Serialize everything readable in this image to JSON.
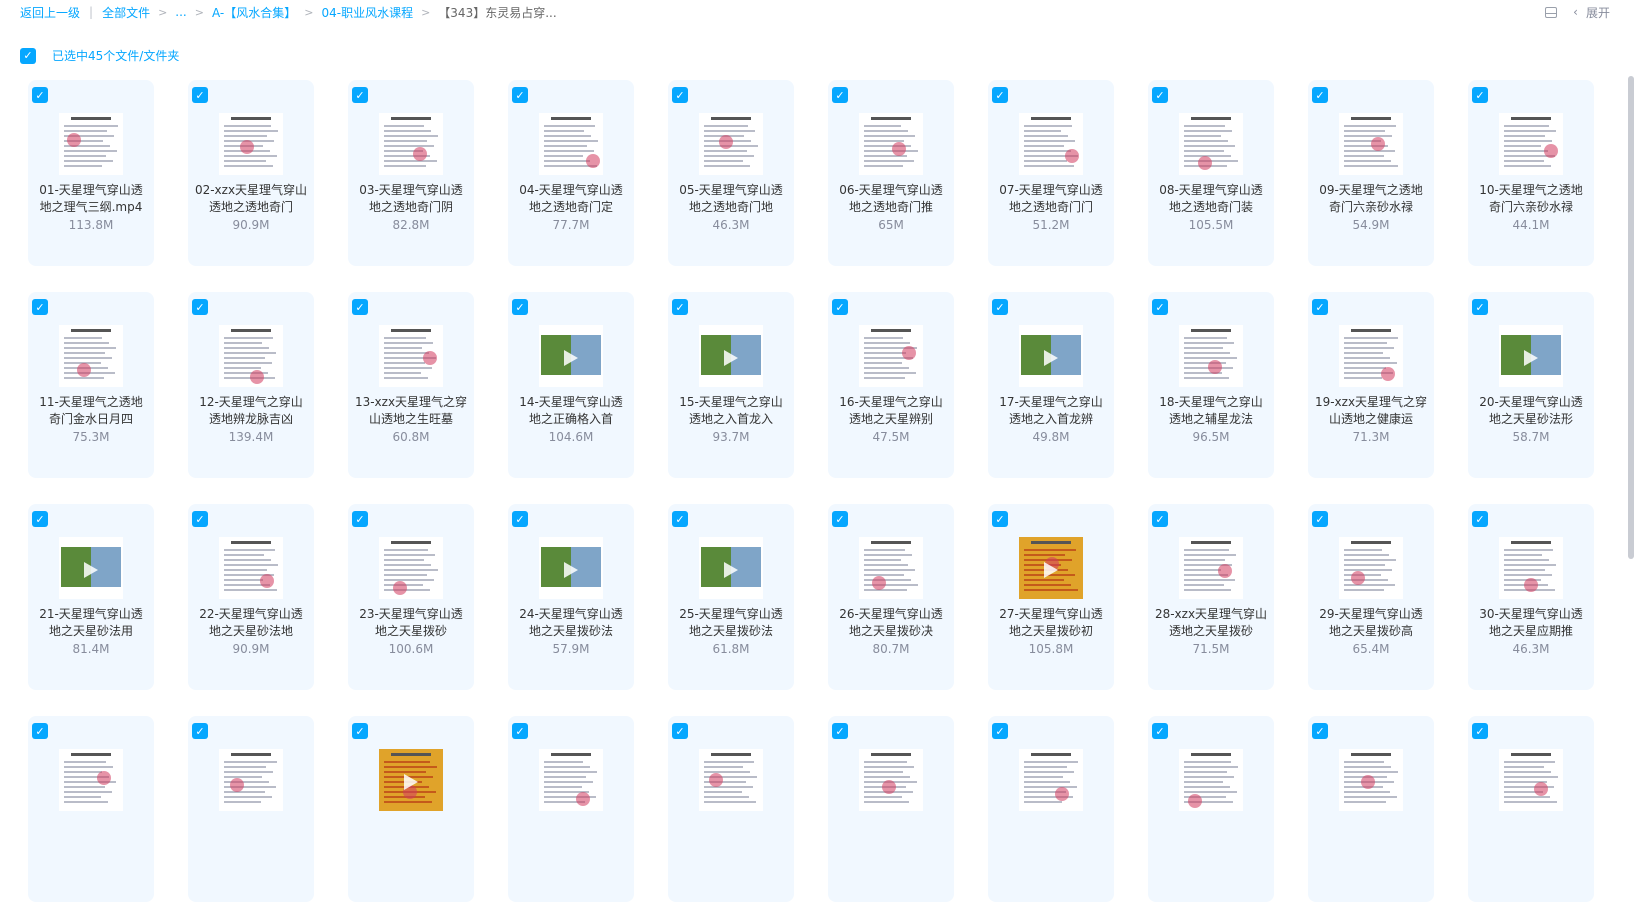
{
  "breadcrumb": {
    "back": "返回上一级",
    "items": [
      "全部文件",
      "...",
      "A-【风水合集】",
      "04-职业风水课程",
      "【343】东灵易占穿..."
    ]
  },
  "toolbar": {
    "expand_label": "展开"
  },
  "selection": {
    "text": "已选中45个文件/文件夹"
  },
  "files": [
    {
      "name": "01-天星理气穿山透地之理气三纲.mp4",
      "size": "113.8M",
      "thumb": "doc"
    },
    {
      "name": "02-xzx天星理气穿山透地之透地奇门",
      "size": "90.9M",
      "thumb": "doc"
    },
    {
      "name": "03-天星理气穿山透地之透地奇门阴",
      "size": "82.8M",
      "thumb": "doc"
    },
    {
      "name": "04-天星理气穿山透地之透地奇门定",
      "size": "77.7M",
      "thumb": "doc"
    },
    {
      "name": "05-天星理气穿山透地之透地奇门地",
      "size": "46.3M",
      "thumb": "doc"
    },
    {
      "name": "06-天星理气穿山透地之透地奇门推",
      "size": "65M",
      "thumb": "doc"
    },
    {
      "name": "07-天星理气穿山透地之透地奇门门",
      "size": "51.2M",
      "thumb": "doc"
    },
    {
      "name": "08-天星理气穿山透地之透地奇门装",
      "size": "105.5M",
      "thumb": "doc"
    },
    {
      "name": "09-天星理气之透地奇门六亲砂水禄",
      "size": "54.9M",
      "thumb": "doc"
    },
    {
      "name": "10-天星理气之透地奇门六亲砂水禄",
      "size": "44.1M",
      "thumb": "doc"
    },
    {
      "name": "11-天星理气之透地奇门金水日月四",
      "size": "75.3M",
      "thumb": "doc"
    },
    {
      "name": "12-天星理气之穿山透地辨龙脉吉凶",
      "size": "139.4M",
      "thumb": "doc"
    },
    {
      "name": "13-xzx天星理气之穿山透地之生旺墓",
      "size": "60.8M",
      "thumb": "doc"
    },
    {
      "name": "14-天星理气穿山透地之正确格入首",
      "size": "104.6M",
      "thumb": "photo"
    },
    {
      "name": "15-天星理气之穿山透地之入首龙入",
      "size": "93.7M",
      "thumb": "photo"
    },
    {
      "name": "16-天星理气之穿山透地之天星辨别",
      "size": "47.5M",
      "thumb": "doc"
    },
    {
      "name": "17-天星理气之穿山透地之入首龙辨",
      "size": "49.8M",
      "thumb": "photo"
    },
    {
      "name": "18-天星理气之穿山透地之辅星龙法",
      "size": "96.5M",
      "thumb": "doc"
    },
    {
      "name": "19-xzx天星理气之穿山透地之健康运",
      "size": "71.3M",
      "thumb": "doc"
    },
    {
      "name": "20-天星理气穿山透地之天星砂法形",
      "size": "58.7M",
      "thumb": "photo"
    },
    {
      "name": "21-天星理气穿山透地之天星砂法用",
      "size": "81.4M",
      "thumb": "photo"
    },
    {
      "name": "22-天星理气穿山透地之天星砂法地",
      "size": "90.9M",
      "thumb": "doc"
    },
    {
      "name": "23-天星理气穿山透地之天星拨砂",
      "size": "100.6M",
      "thumb": "doc"
    },
    {
      "name": "24-天星理气穿山透地之天星拨砂法",
      "size": "57.9M",
      "thumb": "photo"
    },
    {
      "name": "25-天星理气穿山透地之天星拨砂法",
      "size": "61.8M",
      "thumb": "photo"
    },
    {
      "name": "26-天星理气穿山透地之天星拨砂决",
      "size": "80.7M",
      "thumb": "doc"
    },
    {
      "name": "27-天星理气穿山透地之天星拨砂初",
      "size": "105.8M",
      "thumb": "orange"
    },
    {
      "name": "28-xzx天星理气穿山透地之天星拨砂",
      "size": "71.5M",
      "thumb": "doc"
    },
    {
      "name": "29-天星理气穿山透地之天星拨砂高",
      "size": "65.4M",
      "thumb": "doc"
    },
    {
      "name": "30-天星理气穿山透地之天星应期推",
      "size": "46.3M",
      "thumb": "doc"
    },
    {
      "name": "",
      "size": "",
      "thumb": "doc"
    },
    {
      "name": "",
      "size": "",
      "thumb": "doc"
    },
    {
      "name": "",
      "size": "",
      "thumb": "orange"
    },
    {
      "name": "",
      "size": "",
      "thumb": "doc"
    },
    {
      "name": "",
      "size": "",
      "thumb": "doc"
    },
    {
      "name": "",
      "size": "",
      "thumb": "doc"
    },
    {
      "name": "",
      "size": "",
      "thumb": "doc"
    },
    {
      "name": "",
      "size": "",
      "thumb": "doc"
    },
    {
      "name": "",
      "size": "",
      "thumb": "doc"
    },
    {
      "name": "",
      "size": "",
      "thumb": "doc"
    }
  ],
  "colors": {
    "accent": "#06a7ff",
    "card_bg": "#f1f8ff"
  },
  "icons": {
    "checkbox": "checkmark-icon",
    "play": "play-icon",
    "panel": "panel-icon",
    "chevron": "chevron-left-icon"
  }
}
